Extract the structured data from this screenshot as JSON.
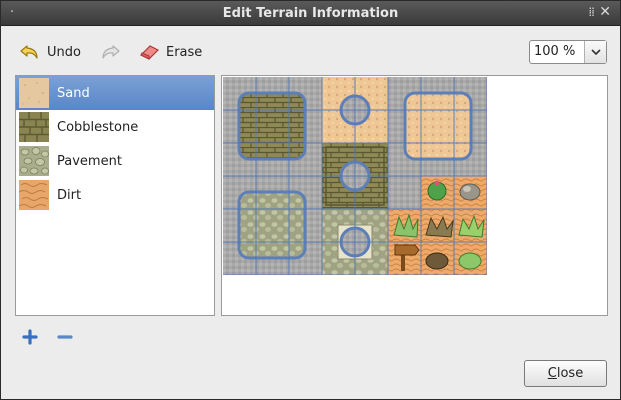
{
  "window": {
    "title": "Edit Terrain Information"
  },
  "toolbar": {
    "undo_label": "Undo",
    "erase_label": "Erase",
    "zoom_value": "100 %"
  },
  "terrains": [
    {
      "name": "Sand",
      "selected": true
    },
    {
      "name": "Cobblestone",
      "selected": false
    },
    {
      "name": "Pavement",
      "selected": false
    },
    {
      "name": "Dirt",
      "selected": false
    }
  ],
  "footer": {
    "close_first": "C",
    "close_rest": "lose"
  },
  "colors": {
    "selection": "#5a86c6",
    "sand": "#e8c9a0",
    "cobble": "#8a8452",
    "pavement": "#a8ad8a",
    "dirt": "#e7a66a",
    "grid": "#4f78b8"
  }
}
